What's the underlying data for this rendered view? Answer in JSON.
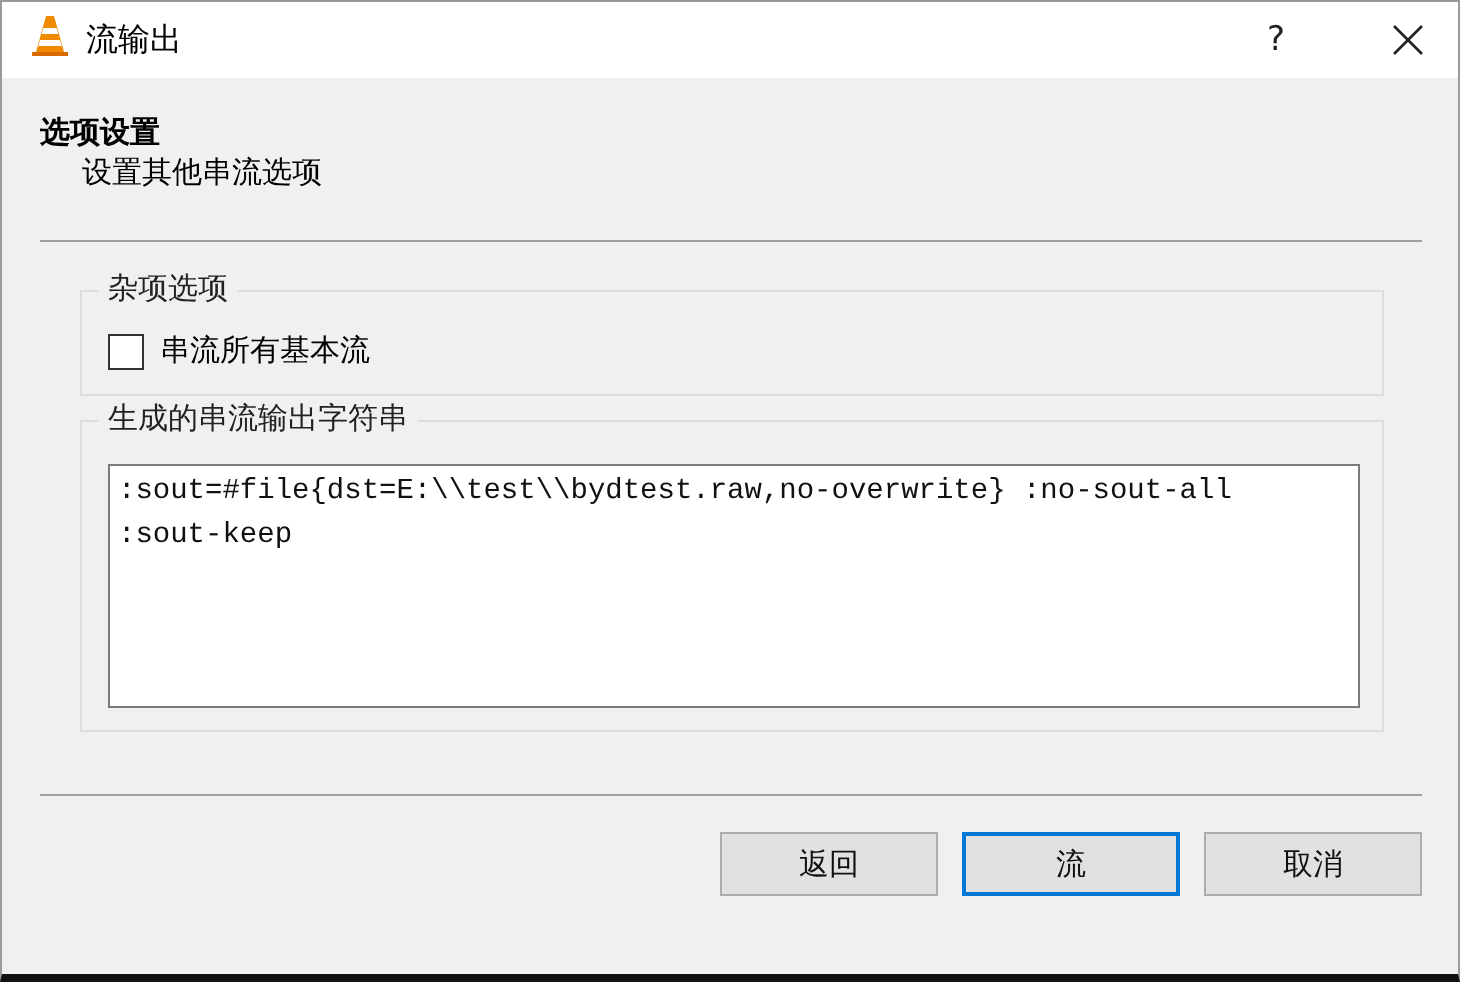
{
  "window": {
    "title": "流输出",
    "help": "?"
  },
  "header": {
    "title": "选项设置",
    "subtitle": "设置其他串流选项"
  },
  "groups": [
    {
      "kind": "options",
      "title": "杂项选项",
      "checkboxes": [
        {
          "label": "串流所有基本流",
          "checked": false
        }
      ]
    },
    {
      "kind": "output",
      "title": "生成的串流输出字符串",
      "value": ":sout=#file{dst=E:\\\\test\\\\bydtest.raw,no-overwrite} :no-sout-all :sout-keep"
    }
  ],
  "buttons": [
    {
      "label": "返回",
      "default": false
    },
    {
      "label": "流",
      "default": true
    },
    {
      "label": "取消",
      "default": false
    }
  ]
}
